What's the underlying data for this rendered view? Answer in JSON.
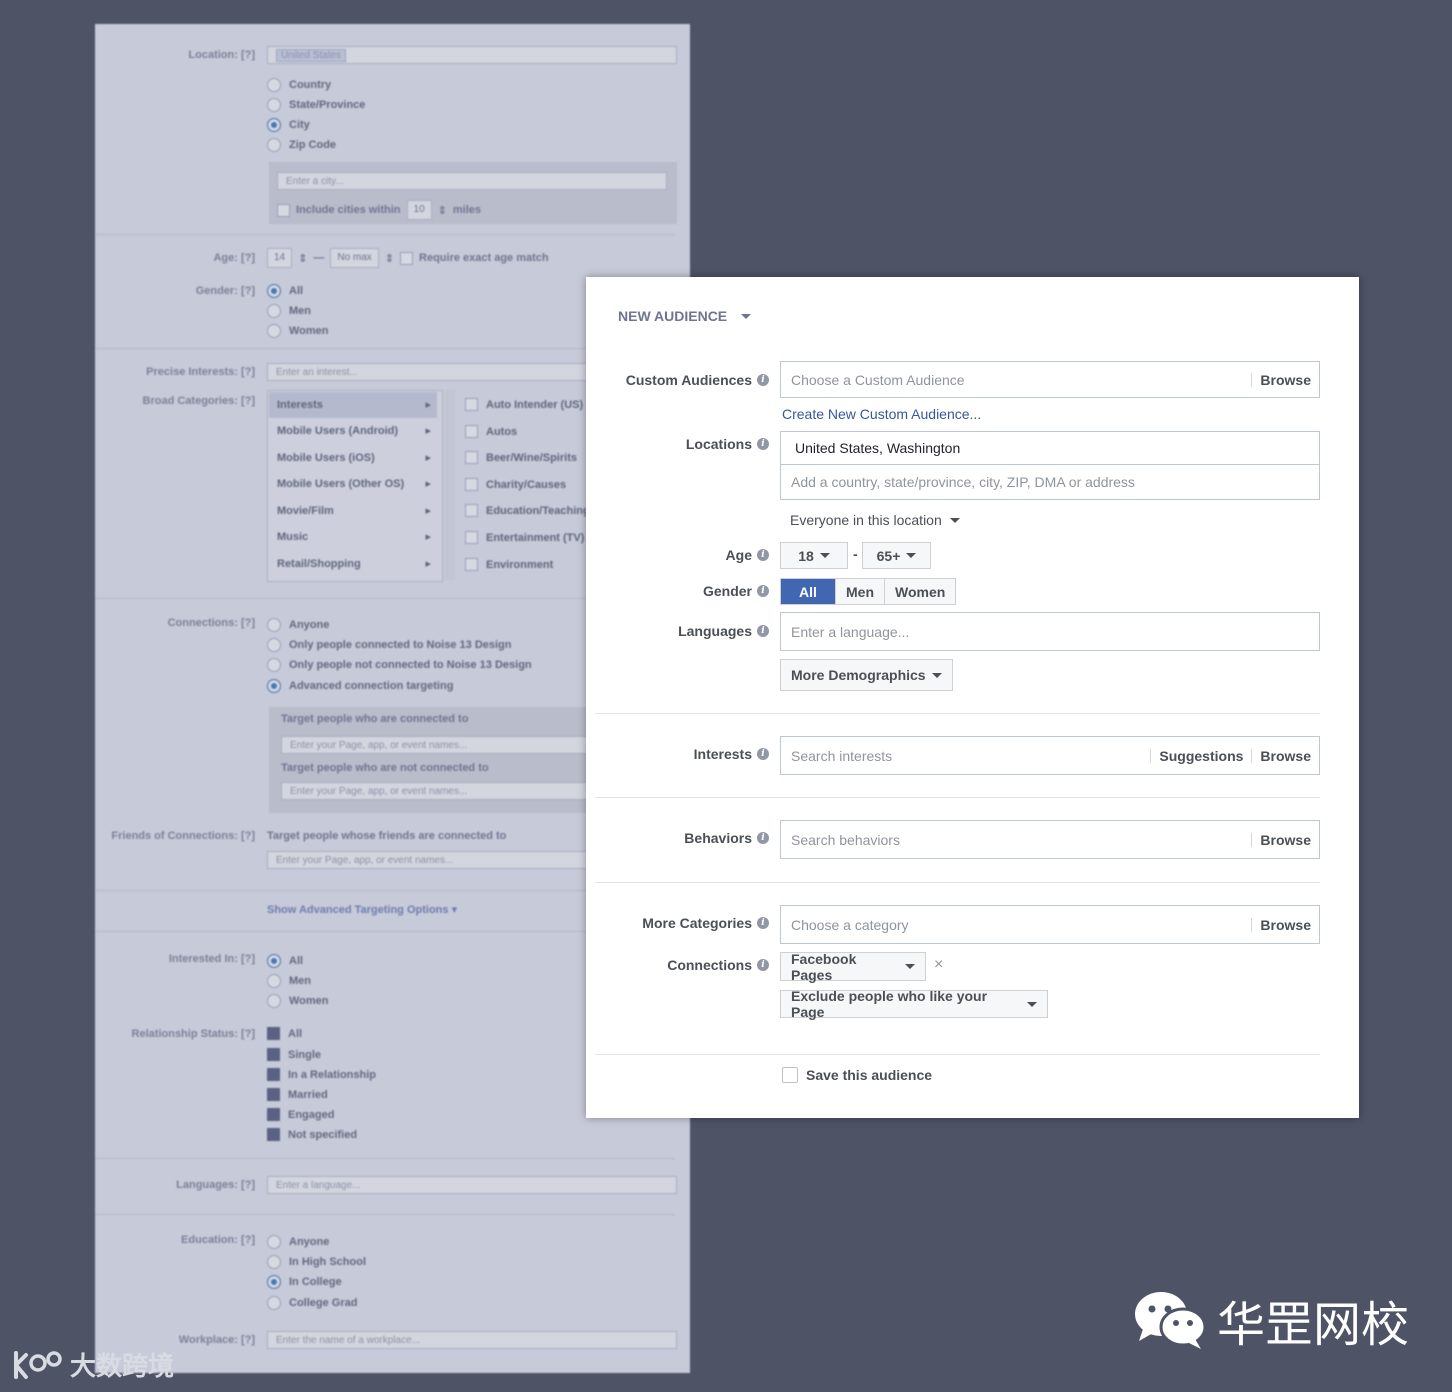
{
  "old": {
    "location_label": "Location:",
    "help": "[?]",
    "location_token": "United States",
    "location_options": [
      "Country",
      "State/Province",
      "City",
      "Zip Code"
    ],
    "city_placeholder": "Enter a city...",
    "include_cities": "Include cities within",
    "miles_value": "10",
    "miles": "miles",
    "age_label": "Age:",
    "age_min": "14",
    "age_dash": "—",
    "age_max": "No max",
    "exact_age": "Require exact age match",
    "gender_label": "Gender:",
    "gender_options": [
      "All",
      "Men",
      "Women"
    ],
    "precise_label": "Precise Interests:",
    "precise_placeholder": "Enter an interest...",
    "broad_label": "Broad Categories:",
    "categories": [
      "Interests",
      "Mobile Users (Android)",
      "Mobile Users (iOS)",
      "Mobile Users (Other OS)",
      "Movie/Film",
      "Music",
      "Retail/Shopping"
    ],
    "subcategories": [
      "Auto Intender (US)",
      "Autos",
      "Beer/Wine/Spirits",
      "Charity/Causes",
      "Education/Teaching",
      "Entertainment (TV)",
      "Environment"
    ],
    "connections_label": "Connections:",
    "connection_options": [
      "Anyone",
      "Only people connected to Noise 13 Design",
      "Only people not connected to Noise 13 Design",
      "Advanced connection targeting"
    ],
    "target_connected": "Target people who are connected to",
    "target_not_connected": "Target people who are not connected to",
    "page_placeholder": "Enter your Page, app, or event names...",
    "friends_label": "Friends of Connections:",
    "friends_target": "Target people whose friends are connected to",
    "show_advanced": "Show Advanced Targeting Options",
    "interested_label": "Interested In:",
    "interested_options": [
      "All",
      "Men",
      "Women"
    ],
    "relationship_label": "Relationship Status:",
    "relationship_options": [
      "All",
      "Single",
      "In a Relationship",
      "Married",
      "Engaged",
      "Not specified"
    ],
    "languages_label": "Languages:",
    "language_placeholder": "Enter a language...",
    "education_label": "Education:",
    "education_options": [
      "Anyone",
      "In High School",
      "In College",
      "College Grad"
    ],
    "workplace_label": "Workplace:",
    "workplace_placeholder": "Enter the name of a workplace..."
  },
  "new": {
    "header": "NEW AUDIENCE",
    "custom_audiences_label": "Custom Audiences",
    "custom_audience_placeholder": "Choose a Custom Audience",
    "browse": "Browse",
    "create_custom": "Create New Custom Audience...",
    "locations_label": "Locations",
    "location_value": "United States, Washington",
    "location_placeholder": "Add a country, state/province, city, ZIP, DMA or address",
    "location_scope": "Everyone in this location",
    "age_label": "Age",
    "age_min": "18",
    "age_dash": "-",
    "age_max": "65+",
    "gender_label": "Gender",
    "gender_options": [
      "All",
      "Men",
      "Women"
    ],
    "languages_label": "Languages",
    "language_placeholder": "Enter a language...",
    "more_demographics": "More Demographics",
    "interests_label": "Interests",
    "interests_placeholder": "Search interests",
    "suggestions": "Suggestions",
    "behaviors_label": "Behaviors",
    "behaviors_placeholder": "Search behaviors",
    "more_categories_label": "More Categories",
    "category_placeholder": "Choose a category",
    "connections_label": "Connections",
    "connection_type": "Facebook Pages",
    "remove": "×",
    "exclude_option": "Exclude people who like your Page",
    "save_audience": "Save this audience"
  },
  "watermarks": {
    "left": "大数跨境",
    "right": "华罡网校"
  },
  "colors": {
    "background": "#4e5365",
    "accent": "#4267b2",
    "link": "#365899"
  }
}
